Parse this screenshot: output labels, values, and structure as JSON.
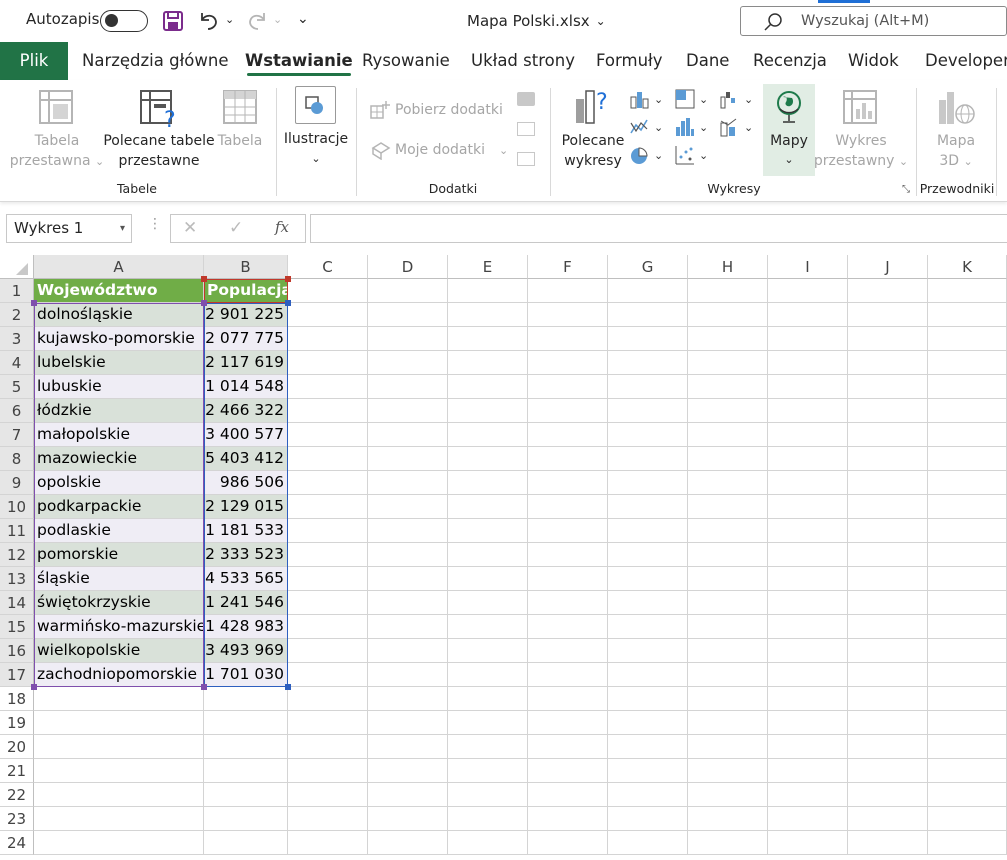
{
  "titlebar": {
    "autosave_label": "Autozapis",
    "autosave_state": "off",
    "filename": "Mapa Polski.xlsx",
    "search_placeholder": "Wyszukaj (Alt+M)"
  },
  "tabs": [
    "Plik",
    "Narzędzia główne",
    "Wstawianie",
    "Rysowanie",
    "Układ strony",
    "Formuły",
    "Dane",
    "Recenzja",
    "Widok",
    "Developer"
  ],
  "active_tab": "Wstawianie",
  "ribbon": {
    "groups": {
      "tabele": "Tabele",
      "dodatki": "Dodatki",
      "wykresy": "Wykresy",
      "przewodniki": "Przewodniki"
    },
    "tabela_przestawna": [
      "Tabela",
      "przestawna"
    ],
    "polecane_tabele": [
      "Polecane tabele",
      "przestawne"
    ],
    "tabela": "Tabela",
    "ilustracje": "Ilustracje",
    "pobierz_dodatki": "Pobierz dodatki",
    "moje_dodatki": "Moje dodatki",
    "polecane_wykresy": [
      "Polecane",
      "wykresy"
    ],
    "mapy": "Mapy",
    "wykres_przestawny": [
      "Wykres",
      "przestawny"
    ],
    "mapa_3d": [
      "Mapa",
      "3D"
    ]
  },
  "formula_bar": {
    "name_box": "Wykres 1",
    "formula": ""
  },
  "columns": [
    "A",
    "B",
    "C",
    "D",
    "E",
    "F",
    "G",
    "H",
    "I",
    "J",
    "K"
  ],
  "rows": [
    "1",
    "2",
    "3",
    "4",
    "5",
    "6",
    "7",
    "8",
    "9",
    "10",
    "11",
    "12",
    "13",
    "14",
    "15",
    "16",
    "17",
    "18",
    "19",
    "20",
    "21",
    "22",
    "23",
    "24"
  ],
  "table": {
    "headers": [
      "Województwo",
      "Populacja"
    ],
    "data": [
      [
        "dolnośląskie",
        "2 901 225"
      ],
      [
        "kujawsko-pomorskie",
        "2 077 775"
      ],
      [
        "lubelskie",
        "2 117 619"
      ],
      [
        "lubuskie",
        "1 014 548"
      ],
      [
        "łódzkie",
        "2 466 322"
      ],
      [
        "małopolskie",
        "3 400 577"
      ],
      [
        "mazowieckie",
        "5 403 412"
      ],
      [
        "opolskie",
        "986 506"
      ],
      [
        "podkarpackie",
        "2 129 015"
      ],
      [
        "podlaskie",
        "1 181 533"
      ],
      [
        "pomorskie",
        "2 333 523"
      ],
      [
        "śląskie",
        "4 533 565"
      ],
      [
        "świętokrzyskie",
        "1 241 546"
      ],
      [
        "warmińsko-mazurskie",
        "1 428 983"
      ],
      [
        "wielkopolskie",
        "3 493 969"
      ],
      [
        "zachodniopomorskie",
        "1 701 030"
      ]
    ]
  },
  "colors": {
    "accent": "#217346",
    "header_fill": "#70ad47",
    "row_even": "#d9e1d9",
    "row_odd": "#efedf5",
    "range_a": "#7f4fad",
    "range_b": "#2e5fbf",
    "range_header": "#c0392b"
  }
}
